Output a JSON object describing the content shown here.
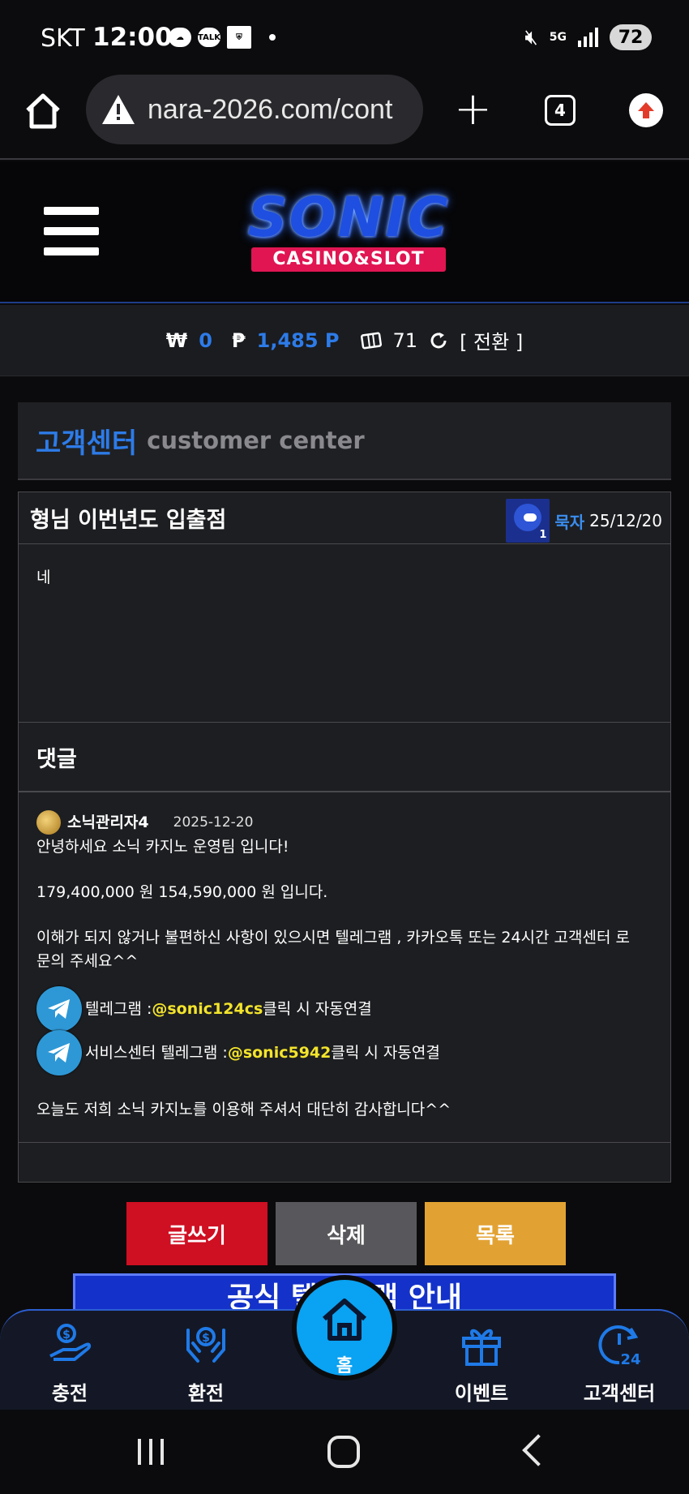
{
  "status_bar": {
    "carrier": "SKT",
    "time": "12:00",
    "talk_label": "TALK",
    "network": "5G",
    "battery": "72"
  },
  "browser": {
    "url": "nara-2026.com/cont",
    "tab_count": "4"
  },
  "header": {
    "logo_top": "SONIC",
    "logo_bottom": "CASINO&SLOT"
  },
  "balance": {
    "won_symbol": "₩",
    "won_value": "0",
    "point_symbol": "₱",
    "point_value": "1,485 P",
    "coupon_value": "71",
    "convert_label": "[ 전환 ]"
  },
  "section": {
    "title_ko": "고객센터",
    "title_en": "customer center"
  },
  "post": {
    "title": "형님 이번년도 입출점",
    "avatar_level": "1",
    "author": "묵자",
    "date": "25/12/20",
    "body": "네"
  },
  "comments": {
    "heading": "댓글",
    "items": [
      {
        "author": "소닉관리자4",
        "date": "2025-12-20",
        "line1": "안녕하세요 소닉 카지노 운영팀 입니다!",
        "line2": "179,400,000 원 154,590,000 원 입니다.",
        "line3a": "이해가 되지 않거나 불편하신 사항이 있으시면 텔레그램 , 카카오톡 또는 24시간 고객센터 로",
        "line3b": "문의 주세요^^",
        "tg1_prefix": "텔레그램 : ",
        "tg1_handle": "@sonic124cs",
        "tg1_suffix": " 클릭 시 자동연결",
        "tg2_prefix": "서비스센터 텔레그램 : ",
        "tg2_handle": "@sonic5942",
        "tg2_suffix": " 클릭 시 자동연결",
        "closing": "오늘도 저희 소닉 카지노를 이용해 주셔서 대단히 감사합니다^^"
      }
    ]
  },
  "actions": {
    "write": "글쓰기",
    "delete": "삭제",
    "list": "목록"
  },
  "banner": {
    "text": "공식 텔레그램 안내"
  },
  "bottom_nav": {
    "deposit": "충전",
    "withdraw": "환전",
    "home": "홈",
    "event": "이벤트",
    "support": "고객센터"
  },
  "colors": {
    "accent_blue": "#2d7be8",
    "write_red": "#cf0f22",
    "delete_gray": "#58585c",
    "list_orange": "#e2a233",
    "telegram_handle_yellow": "#f3e42b",
    "home_button": "#0aa2f2"
  }
}
